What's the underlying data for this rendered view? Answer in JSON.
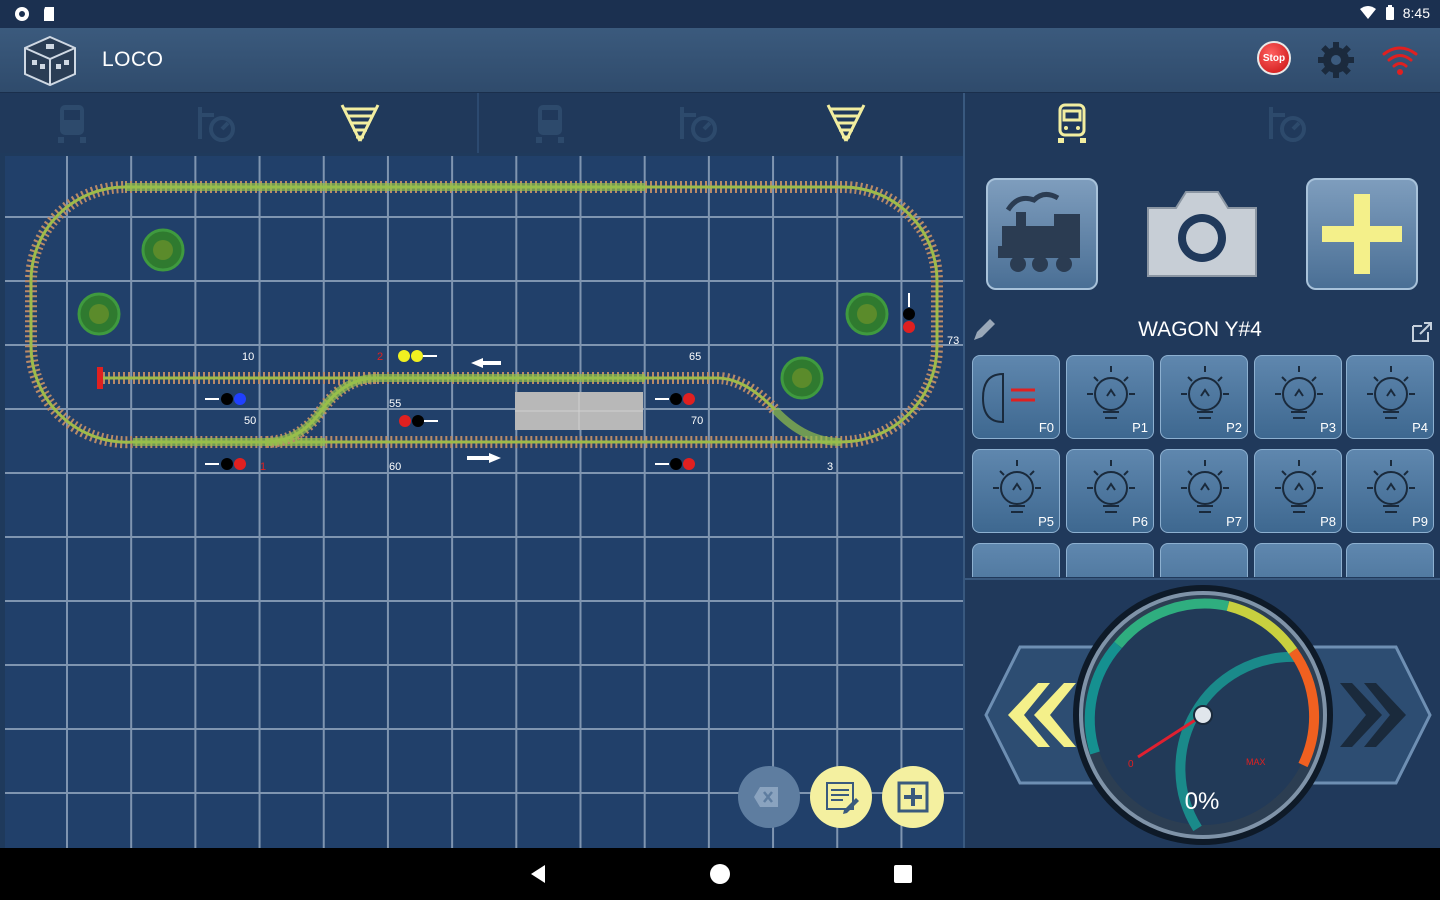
{
  "status_bar": {
    "time": "8:45"
  },
  "app_bar": {
    "title": "LOCO",
    "stop_label": "Stop"
  },
  "toolbar": {
    "left_icons": [
      "train-icon",
      "speedometer-icon",
      "track-icon",
      "train-icon",
      "speedometer-icon",
      "track-icon"
    ],
    "right_icons": [
      "train-icon",
      "speedometer-icon"
    ]
  },
  "layout_labels": {
    "l10": "10",
    "l2": "2",
    "l65": "65",
    "l73": "73",
    "l50": "50",
    "l55": "55",
    "l70": "70",
    "l1": "1",
    "l60": "60",
    "l3": "3"
  },
  "loco": {
    "name": "WAGON Y#4",
    "functions": [
      "F0",
      "P1",
      "P2",
      "P3",
      "P4",
      "P5",
      "P6",
      "P7",
      "P8",
      "P9"
    ]
  },
  "speed": {
    "percent": "0%",
    "min_label": "0",
    "max_label": "MAX",
    "value": 0
  },
  "colors": {
    "accent_yellow": "#f4f08a",
    "stop_red": "#d01818",
    "grid_bg": "#21406a"
  }
}
